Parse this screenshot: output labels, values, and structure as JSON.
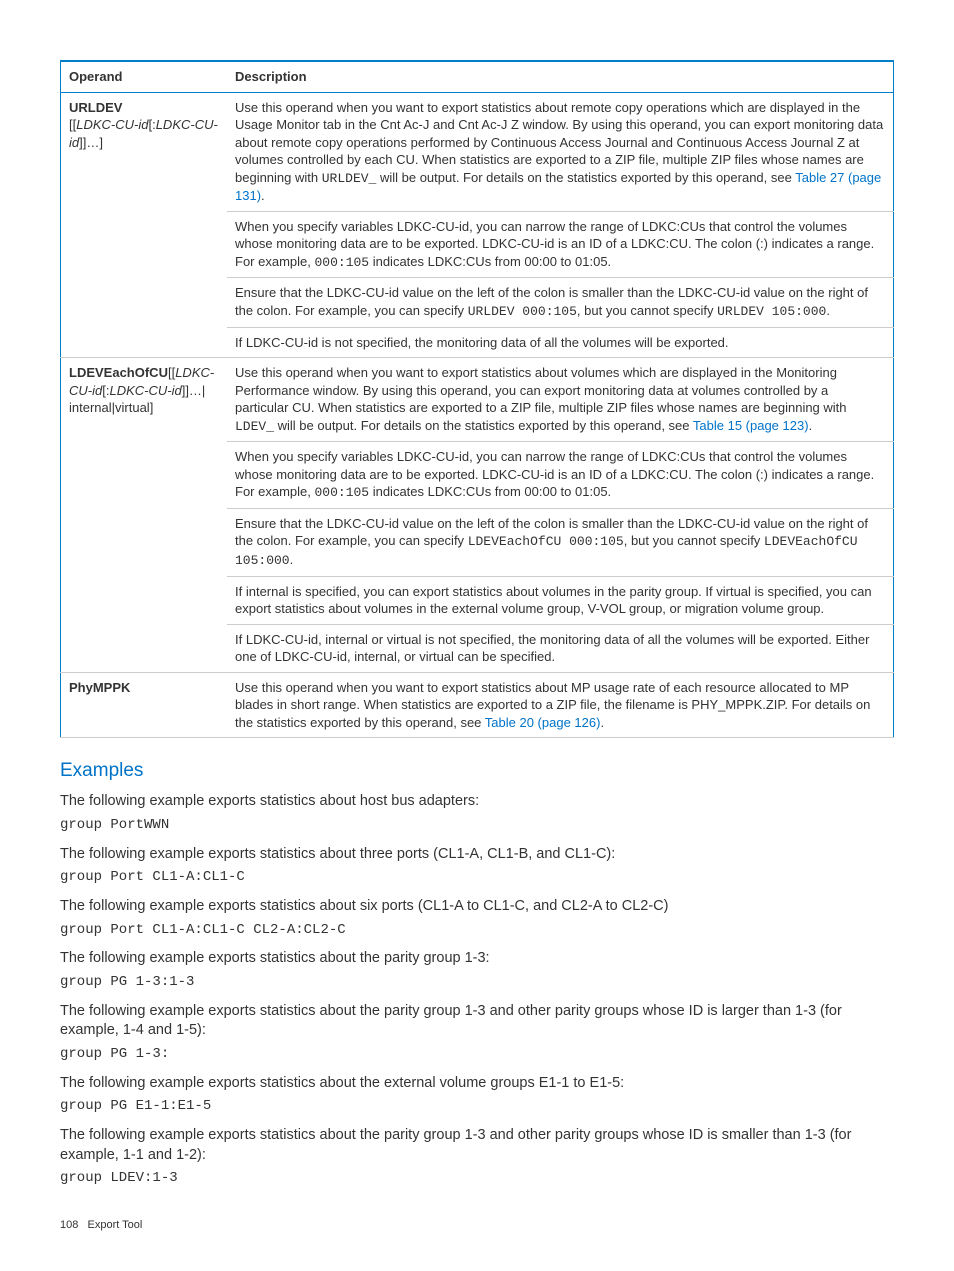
{
  "table": {
    "headers": [
      "Operand",
      "Description"
    ],
    "rows": [
      {
        "operand_bold": "URLDEV",
        "operand_args_pre": "[[",
        "operand_args_it1": "LDKC-CU-id",
        "operand_args_mid": "[:",
        "operand_args_it2": "LDKC-CU-id",
        "operand_args_post": "]]…]",
        "paras": [
          {
            "text_pre": "Use this operand when you want to export statistics about remote copy operations which are displayed in the Usage Monitor tab in the Cnt Ac-J and Cnt Ac-J Z window. By using this operand, you can export monitoring data about remote copy operations performed by Continuous Access Journal and Continuous Access Journal Z at volumes controlled by each CU. When statistics are exported to a ZIP file, multiple ZIP files whose names are beginning with ",
            "mono1": "URLDEV_",
            "text_mid": " will be output. For details on the statistics exported by this operand, see ",
            "link": "Table 27 (page 131)",
            "text_post": "."
          },
          {
            "text_pre": "When you specify variables LDKC-CU-id, you can narrow the range of LDKC:CUs that control the volumes whose monitoring data are to be exported. LDKC-CU-id is an ID of a LDKC:CU. The colon (:) indicates a range. For example, ",
            "mono1": "000:105",
            "text_mid": " indicates LDKC:CUs from 00:00 to 01:05.",
            "link": "",
            "text_post": ""
          },
          {
            "text_pre": "Ensure that the LDKC-CU-id value on the left of the colon is smaller than the LDKC-CU-id value on the right of the colon. For example, you can specify ",
            "mono1": "URLDEV 000:105",
            "text_mid": ", but you cannot specify ",
            "mono2": "URLDEV 105:000",
            "text_post2": "."
          },
          {
            "text_pre": "If LDKC-CU-id is not specified, the monitoring data of all the volumes will be exported."
          }
        ]
      },
      {
        "operand_bold": "LDEVEachOfCU",
        "operand_line1_pre": "[[",
        "operand_line1_it1": "LDKC-CU-id",
        "operand_line1_mid": "[:",
        "operand_line1_it2": "LDKC-CU-id",
        "operand_line1_post": "]]…|",
        "operand_line2": "internal|virtual]",
        "paras": [
          {
            "text_pre": "Use this operand when you want to export statistics about volumes which are displayed in the Monitoring Performance window. By using this operand, you can export monitoring data at volumes controlled by a particular CU. When statistics are exported to a ZIP file, multiple ZIP files whose names are beginning with ",
            "mono1": "LDEV_",
            "text_mid": " will be output. For details on the statistics exported by this operand, see ",
            "link": "Table 15 (page 123)",
            "text_post": "."
          },
          {
            "text_pre": "When you specify variables LDKC-CU-id, you can narrow the range of LDKC:CUs that control the volumes whose monitoring data are to be exported. LDKC-CU-id is an ID of a LDKC:CU. The colon (:) indicates a range. For example, ",
            "mono1": "000:105",
            "text_mid": " indicates LDKC:CUs from 00:00 to 01:05.",
            "link": "",
            "text_post": ""
          },
          {
            "text_pre": "Ensure that the LDKC-CU-id value on the left of the colon is smaller than the LDKC-CU-id value on the right of the colon. For example, you can specify ",
            "mono1": "LDEVEachOfCU 000:105",
            "text_mid": ", but you cannot specify ",
            "mono2": "LDEVEachOfCU 105:000",
            "text_post2": "."
          },
          {
            "text_pre": "If internal is specified, you can export statistics about volumes in the parity group. If virtual is specified, you can export statistics about volumes in the external volume group, V-VOL group, or migration volume group."
          },
          {
            "text_pre": "If LDKC-CU-id, internal or virtual is not specified, the monitoring data of all the volumes will be exported. Either one of LDKC-CU-id, internal, or virtual can be specified."
          }
        ]
      },
      {
        "operand_bold": "PhyMPPK",
        "paras": [
          {
            "text_pre": "Use this operand when you want to export statistics about MP usage rate of each resource allocated to MP blades in short range. When statistics are exported to a ZIP file, the filename is PHY_MPPK.ZIP. For details on the statistics exported by this operand, see ",
            "link": "Table 20 (page 126)",
            "text_post": "."
          }
        ]
      }
    ]
  },
  "examples_heading": "Examples",
  "examples": [
    {
      "text": "The following example exports statistics about host bus adapters:",
      "code": "group PortWWN"
    },
    {
      "text": "The following example exports statistics about three ports (CL1-A, CL1-B, and CL1-C):",
      "code": "group Port CL1-A:CL1-C"
    },
    {
      "text": "The following example exports statistics about six ports (CL1-A to CL1-C, and CL2-A to CL2-C)",
      "code": "group Port CL1-A:CL1-C CL2-A:CL2-C"
    },
    {
      "text": "The following example exports statistics about the parity group 1-3:",
      "code": "group PG 1-3:1-3"
    },
    {
      "text": "The following example exports statistics about the parity group 1-3 and other parity groups whose ID is larger than 1-3 (for example, 1-4 and 1-5):",
      "code": "group PG 1-3:"
    },
    {
      "text": "The following example exports statistics about the external volume groups E1-1 to E1-5:",
      "code": "group PG E1-1:E1-5"
    },
    {
      "text": "The following example exports statistics about the parity group 1-3 and other parity groups whose ID is smaller than 1-3 (for example, 1-1 and 1-2):",
      "code": "group LDEV:1-3"
    }
  ],
  "footer": {
    "page": "108",
    "section": "Export Tool"
  }
}
